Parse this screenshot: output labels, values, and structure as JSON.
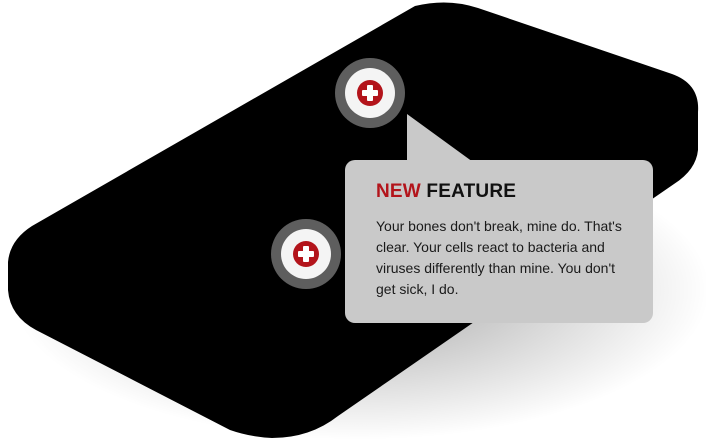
{
  "callout": {
    "title_highlight": "NEW",
    "title_rest": "FEATURE",
    "body": "Your bones don't break, mine do. That's clear. Your cells react to bacteria and viruses differently than mine. You don't get sick, I do."
  },
  "hotspots": [
    {
      "icon": "plus-icon"
    },
    {
      "icon": "plus-icon"
    }
  ],
  "colors": {
    "accent": "#b3141b",
    "device": "#000000",
    "ring": "#5e5e5e",
    "callout_bg": "#c9c9c9",
    "text": "#1a1a1a"
  }
}
